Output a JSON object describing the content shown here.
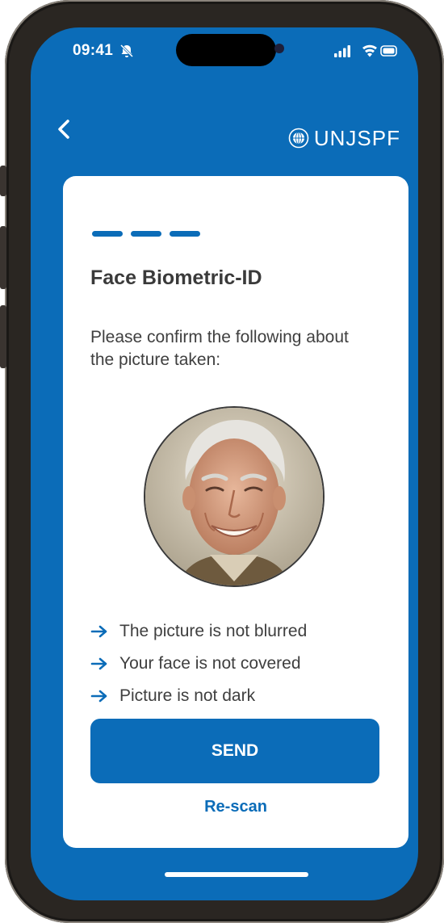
{
  "status": {
    "time": "09:41"
  },
  "header": {
    "logo_text": "UNJSPF",
    "back_icon": "chevron-left-icon",
    "logo_icon": "un-emblem-icon"
  },
  "steps": {
    "total": 3,
    "current": 3
  },
  "card": {
    "title": "Face Biometric-ID",
    "instruction": "Please confirm the following about the picture taken:",
    "checklist": [
      "The picture is not blurred",
      "Your face is not covered",
      "Picture is not dark"
    ],
    "send_label": "SEND",
    "rescan_label": "Re-scan"
  },
  "colors": {
    "primary": "#0b6cb8",
    "card": "#ffffff",
    "text": "#3f3f3f"
  }
}
